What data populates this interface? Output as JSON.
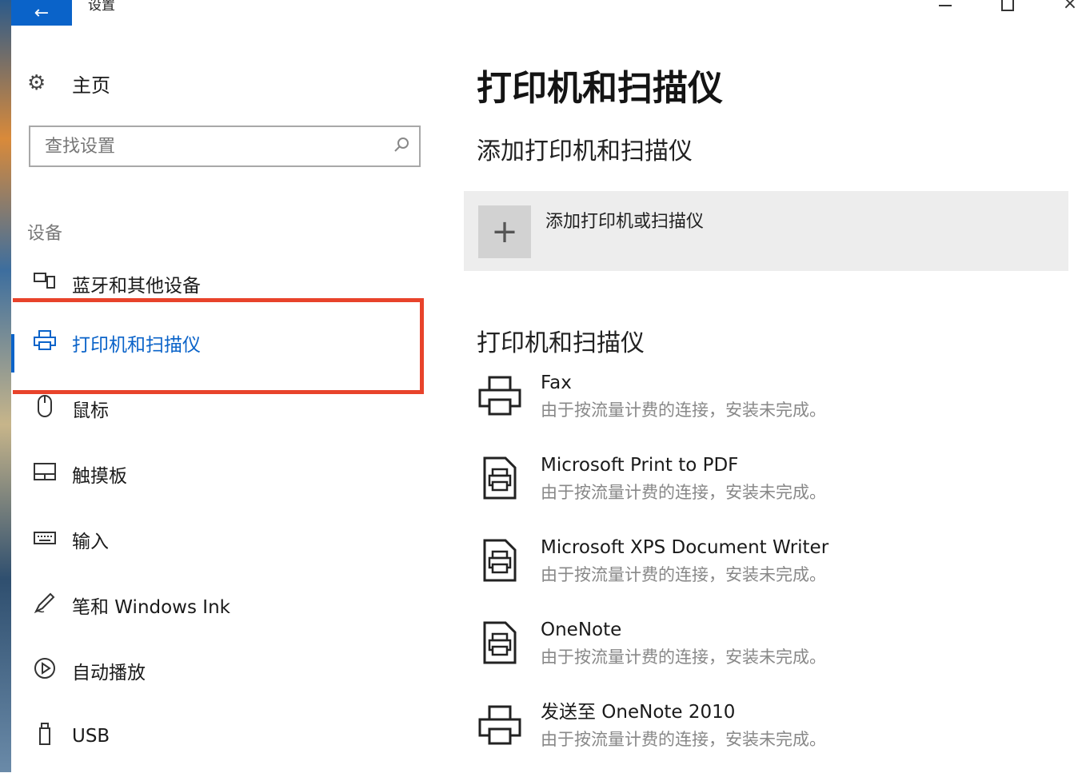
{
  "window": {
    "title": "设置"
  },
  "sidebar": {
    "home_label": "主页",
    "search_placeholder": "查找设置",
    "group_label": "设备",
    "items": [
      {
        "label": "蓝牙和其他设备",
        "icon": "bluetooth-devices-icon"
      },
      {
        "label": "打印机和扫描仪",
        "icon": "printer-icon",
        "active": true
      },
      {
        "label": "鼠标",
        "icon": "mouse-icon"
      },
      {
        "label": "触摸板",
        "icon": "touchpad-icon"
      },
      {
        "label": "输入",
        "icon": "keyboard-icon"
      },
      {
        "label": "笔和 Windows Ink",
        "icon": "pen-icon"
      },
      {
        "label": "自动播放",
        "icon": "autoplay-icon"
      },
      {
        "label": "USB",
        "icon": "usb-icon"
      }
    ]
  },
  "main": {
    "title": "打印机和扫描仪",
    "add_section_title": "添加打印机和扫描仪",
    "add_button_label": "添加打印机或扫描仪",
    "list_section_title": "打印机和扫描仪",
    "printers": [
      {
        "name": "Fax",
        "status": "由于按流量计费的连接，安装未完成。",
        "icon": "printer-icon"
      },
      {
        "name": "Microsoft Print to PDF",
        "status": "由于按流量计费的连接，安装未完成。",
        "icon": "document-printer-icon"
      },
      {
        "name": "Microsoft XPS Document Writer",
        "status": "由于按流量计费的连接，安装未完成。",
        "icon": "document-printer-icon"
      },
      {
        "name": "OneNote",
        "status": "由于按流量计费的连接，安装未完成。",
        "icon": "document-printer-icon"
      },
      {
        "name": "发送至 OneNote 2010",
        "status": "由于按流量计费的连接，安装未完成。",
        "icon": "printer-icon"
      }
    ]
  },
  "colors": {
    "accent": "#0a63c9",
    "highlight_box": "#e8432b",
    "tile_bg": "#ededed"
  }
}
